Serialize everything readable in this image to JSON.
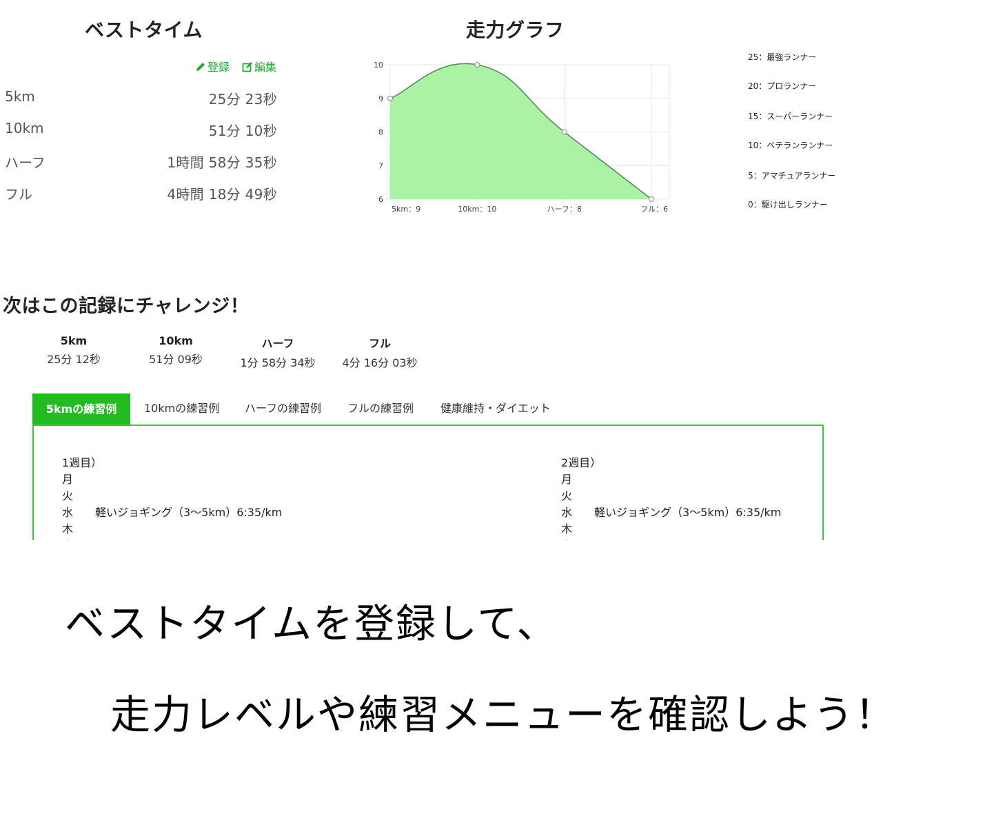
{
  "best": {
    "title": "ベストタイム",
    "register_label": "登録",
    "edit_label": "編集",
    "rows": [
      {
        "label": "5km",
        "time": "25分 23秒"
      },
      {
        "label": "10km",
        "time": "51分 10秒"
      },
      {
        "label": "ハーフ",
        "time": "1時間 58分 35秒"
      },
      {
        "label": "フル",
        "time": "4時間 18分 49秒"
      }
    ]
  },
  "graph": {
    "title": "走力グラフ",
    "legend": [
      "25：最強ランナー",
      "20：プロランナー",
      "15：スーパーランナー",
      "10：ベテランランナー",
      "5：アマチュアランナー",
      "0：駆け出しランナー"
    ]
  },
  "chart_data": {
    "type": "area",
    "categories": [
      "5km：9",
      "10km：10",
      "ハーフ：8",
      "フル：6"
    ],
    "values": [
      9,
      10,
      8,
      6
    ],
    "ylim": [
      6,
      10
    ],
    "yticks": [
      "6",
      "7",
      "8",
      "9",
      "10"
    ],
    "grid": true,
    "fill_color": "#aaf2a4",
    "line_color": "#5a8a5a"
  },
  "challenge": {
    "title": "次はこの記録にチャレンジ！",
    "goals": [
      {
        "label": "5km",
        "time": "25分 12秒"
      },
      {
        "label": "10km",
        "time": "51分 09秒"
      },
      {
        "label": "ハーフ",
        "time": "1分 58分 34秒"
      },
      {
        "label": "フル",
        "time": "4分 16分 03秒"
      }
    ]
  },
  "tabs": [
    "5kmの練習例",
    "10kmの練習例",
    "ハーフの練習例",
    "フルの練習例",
    "健康維持・ダイエット"
  ],
  "plan": {
    "weeks": [
      {
        "heading": "1週目）",
        "days": [
          {
            "day": "月",
            "text": ""
          },
          {
            "day": "火",
            "text": ""
          },
          {
            "day": "水",
            "text": "軽いジョギング（3〜5km）6:35/km"
          },
          {
            "day": "木",
            "text": ""
          },
          {
            "day": "金",
            "text": ""
          }
        ]
      },
      {
        "heading": "2週目）",
        "days": [
          {
            "day": "月",
            "text": ""
          },
          {
            "day": "火",
            "text": ""
          },
          {
            "day": "水",
            "text": "軽いジョギング（3〜5km）6:35/km"
          },
          {
            "day": "木",
            "text": ""
          },
          {
            "day": "金",
            "text": ""
          }
        ]
      }
    ]
  },
  "promo": {
    "line1": "ベストタイムを登録して、",
    "line2": "走力レベルや練習メニューを確認しよう！"
  },
  "colors": {
    "accent": "#22bb22",
    "link": "#22aa33"
  }
}
